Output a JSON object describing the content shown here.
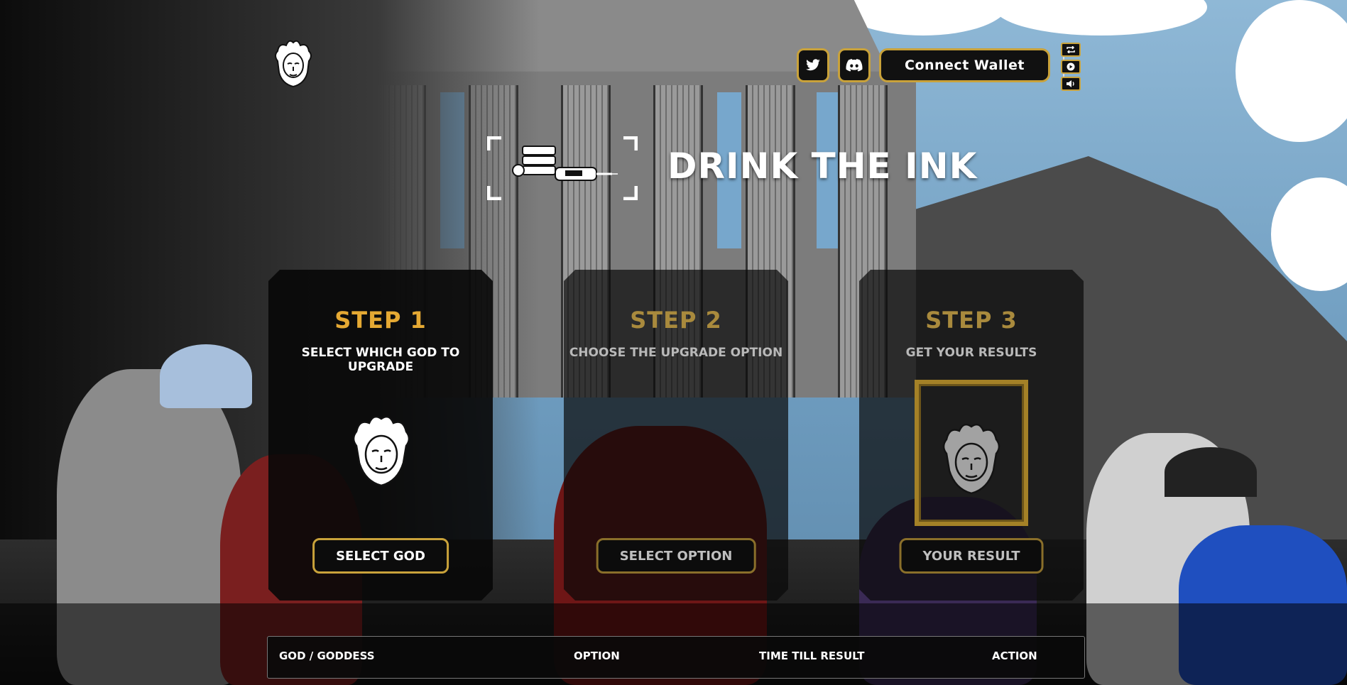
{
  "header": {
    "connect_wallet_label": "Connect Wallet",
    "social": [
      {
        "icon": "twitter-icon"
      },
      {
        "icon": "discord-icon"
      }
    ],
    "media_controls": [
      {
        "icon": "repeat-icon"
      },
      {
        "icon": "play-icon"
      },
      {
        "icon": "volume-icon"
      }
    ]
  },
  "title": "DRINK THE INK",
  "steps": [
    {
      "title": "STEP 1",
      "description": "SELECT WHICH GOD TO UPGRADE",
      "button": "SELECT GOD"
    },
    {
      "title": "STEP 2",
      "description": "CHOOSE THE UPGRADE OPTION",
      "button": "SELECT OPTION"
    },
    {
      "title": "STEP 3",
      "description": "GET YOUR RESULTS",
      "button": "YOUR RESULT"
    }
  ],
  "table": {
    "columns": [
      "GOD / GODDESS",
      "OPTION",
      "TIME TILL RESULT",
      "ACTION"
    ]
  },
  "colors": {
    "accent": "#c9a23a",
    "step_title": "#e5a933",
    "panel": "#0a0a0a"
  }
}
